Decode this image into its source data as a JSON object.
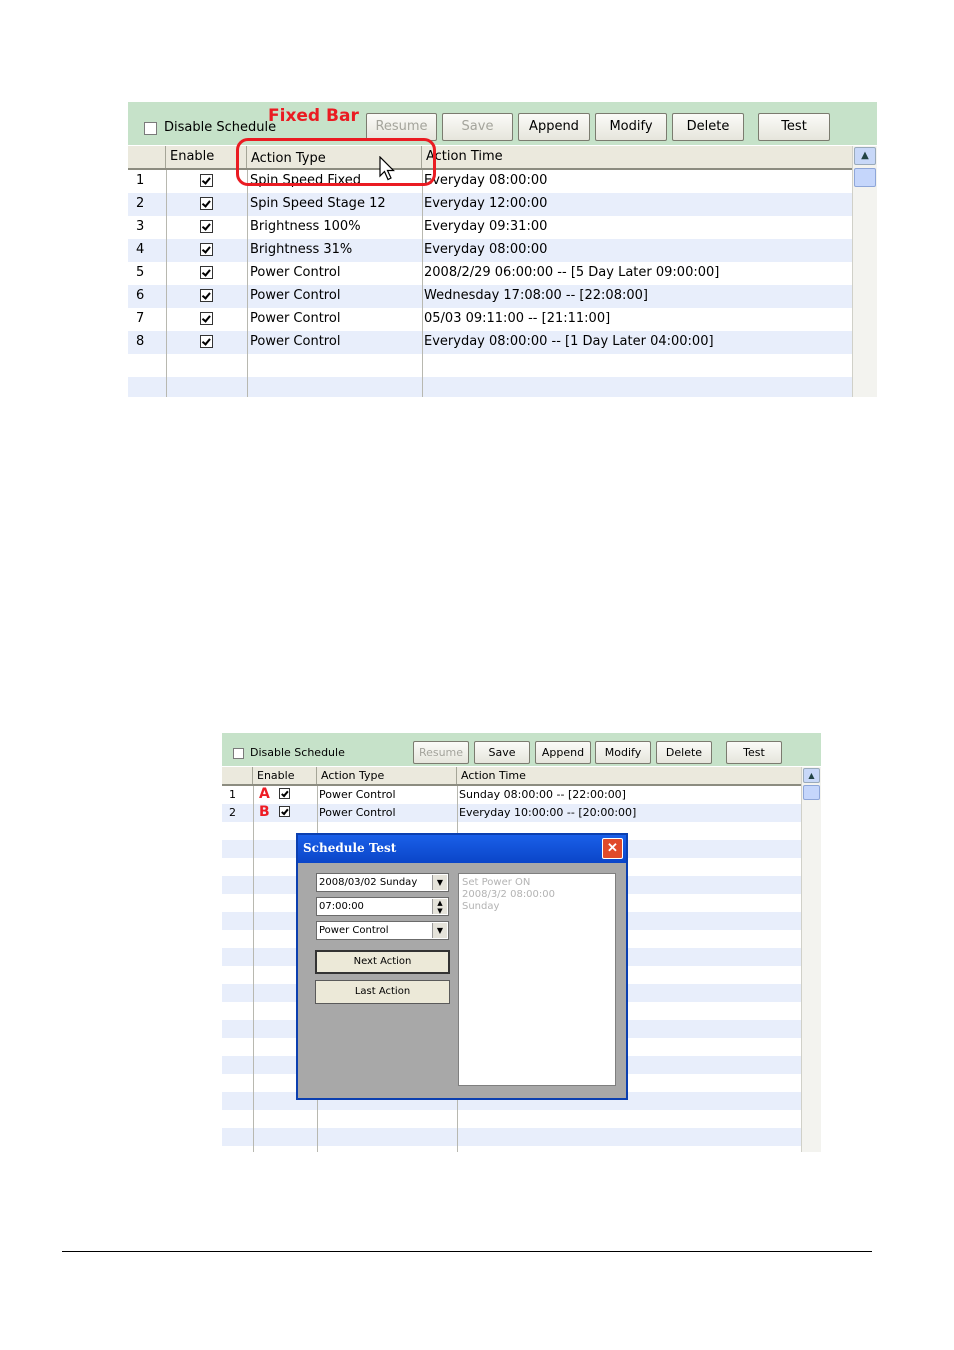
{
  "fig1": {
    "disable_schedule_label": "Disable Schedule",
    "callout_label": "Fixed Bar",
    "buttons": [
      "Resume",
      "Save",
      "Append",
      "Modify",
      "Delete",
      "Test"
    ],
    "columns": [
      "",
      "Enable",
      "Action Type",
      "Action Time"
    ],
    "rows": [
      {
        "no": "1",
        "type": "Spin Speed  Fixed",
        "time": "Everyday  08:00:00"
      },
      {
        "no": "2",
        "type": "Spin Speed  Stage 12",
        "time": "Everyday  12:00:00"
      },
      {
        "no": "3",
        "type": "Brightness  100%",
        "time": "Everyday  09:31:00"
      },
      {
        "no": "4",
        "type": "Brightness  31%",
        "time": "Everyday  08:00:00"
      },
      {
        "no": "5",
        "type": "Power Control",
        "time": "2008/2/29  06:00:00 -- [5 Day Later 09:00:00]"
      },
      {
        "no": "6",
        "type": "Power Control",
        "time": "Wednesday  17:08:00 -- [22:08:00]"
      },
      {
        "no": "7",
        "type": "Power Control",
        "time": "05/03  09:11:00 -- [21:11:00]"
      },
      {
        "no": "8",
        "type": "Power Control",
        "time": "Everyday  08:00:00 -- [1 Day Later 04:00:00]"
      }
    ]
  },
  "fig2": {
    "disable_schedule_label": "Disable Schedule",
    "buttons": [
      "Resume",
      "Save",
      "Append",
      "Modify",
      "Delete",
      "Test"
    ],
    "columns": [
      "",
      "Enable",
      "Action Type",
      "Action Time"
    ],
    "rows": [
      {
        "no": "1",
        "mark": "A",
        "type": "Power Control",
        "time": "Sunday  08:00:00 -- [22:00:00]"
      },
      {
        "no": "2",
        "mark": "B",
        "type": "Power Control",
        "time": "Everyday  10:00:00 -- [20:00:00]"
      }
    ],
    "dialog": {
      "title": "Schedule Test",
      "close_glyph": "✕",
      "date_value": "2008/03/02    Sunday",
      "time_value": "07:00:00",
      "action_value": "Power Control",
      "next_label": "Next Action",
      "last_label": "Last Action",
      "log_lines": [
        "Set Power  ON",
        "2008/3/2  08:00:00",
        "Sunday"
      ]
    }
  }
}
